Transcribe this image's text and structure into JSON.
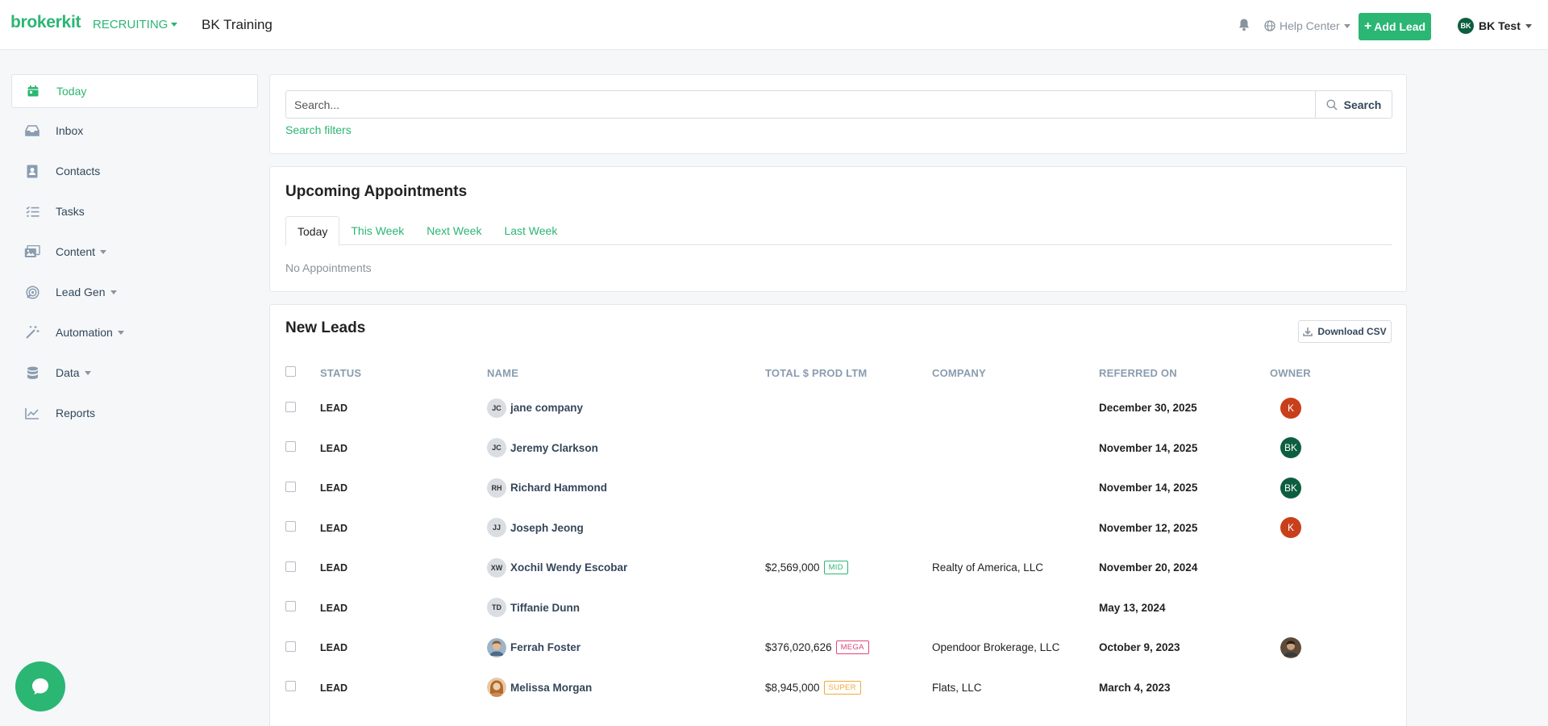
{
  "header": {
    "brand": "brokerkit",
    "mode": "RECRUITING",
    "org": "BK Training",
    "help": "Help Center",
    "add_lead": "Add Lead",
    "add_plus": "+",
    "user_initials": "BK",
    "user_name": "BK Test"
  },
  "sidebar": {
    "items": [
      {
        "label": "Today",
        "icon": "calendar-icon"
      },
      {
        "label": "Inbox",
        "icon": "inbox-icon"
      },
      {
        "label": "Contacts",
        "icon": "contacts-icon"
      },
      {
        "label": "Tasks",
        "icon": "tasks-icon"
      },
      {
        "label": "Content",
        "icon": "content-icon"
      },
      {
        "label": "Lead Gen",
        "icon": "lead-gen-icon"
      },
      {
        "label": "Automation",
        "icon": "wand-icon"
      },
      {
        "label": "Data",
        "icon": "database-icon"
      },
      {
        "label": "Reports",
        "icon": "chart-icon"
      }
    ]
  },
  "search": {
    "placeholder": "Search...",
    "button": "Search",
    "filters_link": "Search filters"
  },
  "appointments": {
    "title": "Upcoming Appointments",
    "tabs": [
      "Today",
      "This Week",
      "Next Week",
      "Last Week"
    ],
    "empty": "No Appointments"
  },
  "leads": {
    "title": "New Leads",
    "csv_button": "Download CSV",
    "columns": [
      "STATUS",
      "NAME",
      "TOTAL $ PROD LTM",
      "COMPANY",
      "REFERRED ON",
      "OWNER"
    ],
    "rows": [
      {
        "status": "LEAD",
        "initials": "JC",
        "name": "jane company",
        "prod": "",
        "tier": "",
        "company": "",
        "referred": "December 30, 2025",
        "owner": "K"
      },
      {
        "status": "LEAD",
        "initials": "JC",
        "name": "Jeremy Clarkson",
        "prod": "",
        "tier": "",
        "company": "",
        "referred": "November 14, 2025",
        "owner": "BK"
      },
      {
        "status": "LEAD",
        "initials": "RH",
        "name": "Richard Hammond",
        "prod": "",
        "tier": "",
        "company": "",
        "referred": "November 14, 2025",
        "owner": "BK"
      },
      {
        "status": "LEAD",
        "initials": "JJ",
        "name": "Joseph Jeong",
        "prod": "",
        "tier": "",
        "company": "",
        "referred": "November 12, 2025",
        "owner": "K"
      },
      {
        "status": "LEAD",
        "initials": "XW",
        "name": "Xochil Wendy Escobar",
        "prod": "$2,569,000",
        "tier": "MID",
        "company": "Realty of America, LLC",
        "referred": "November 20, 2024",
        "owner": ""
      },
      {
        "status": "LEAD",
        "initials": "TD",
        "name": "Tiffanie Dunn",
        "prod": "",
        "tier": "",
        "company": "",
        "referred": "May 13, 2024",
        "owner": ""
      },
      {
        "status": "LEAD",
        "initials": "",
        "name": "Ferrah Foster",
        "prod": "$376,020,626",
        "tier": "MEGA",
        "company": "Opendoor Brokerage, LLC",
        "referred": "October 9, 2023",
        "owner": "photo"
      },
      {
        "status": "LEAD",
        "initials": "",
        "name": "Melissa Morgan",
        "prod": "$8,945,000",
        "tier": "SUPER",
        "company": "Flats, LLC",
        "referred": "March 4, 2023",
        "owner": ""
      }
    ]
  },
  "colors": {
    "brand": "#2bb673",
    "owner_k": "#c8401b",
    "owner_bk": "#0d5e3f",
    "tier_mid": "#2bb673",
    "tier_mega": "#e0457b",
    "tier_super": "#f0a93b"
  }
}
